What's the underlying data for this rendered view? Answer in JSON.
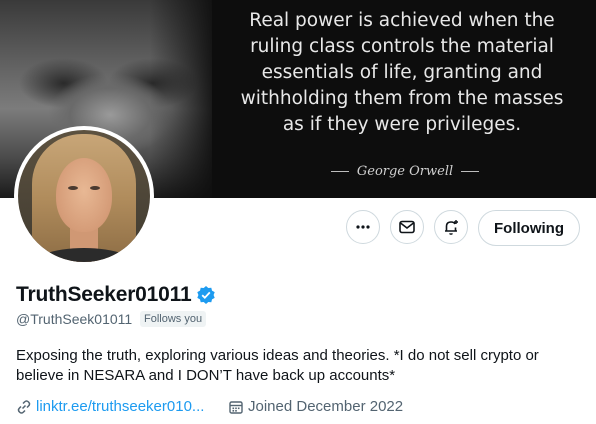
{
  "banner": {
    "quote": "Real power is achieved when the ruling class controls the material essentials of life, granting and withholding them from the masses as if they were privileges.",
    "author": "George Orwell"
  },
  "actions": {
    "more": "more-icon",
    "message": "mail-icon",
    "notifications": "bell-plus-icon",
    "following_label": "Following"
  },
  "profile": {
    "display_name": "TruthSeeker01011",
    "verified": true,
    "handle": "@TruthSeek01011",
    "follows_you": "Follows you",
    "bio": "Exposing the truth, exploring various ideas and theories. *I do not sell crypto or believe in NESARA and I DON’T have back up accounts*",
    "link": "linktr.ee/truthseeker010...",
    "joined": "Joined December 2022"
  },
  "colors": {
    "accent": "#1d9bf0",
    "secondary_text": "#536471",
    "border": "#cfd9de"
  }
}
